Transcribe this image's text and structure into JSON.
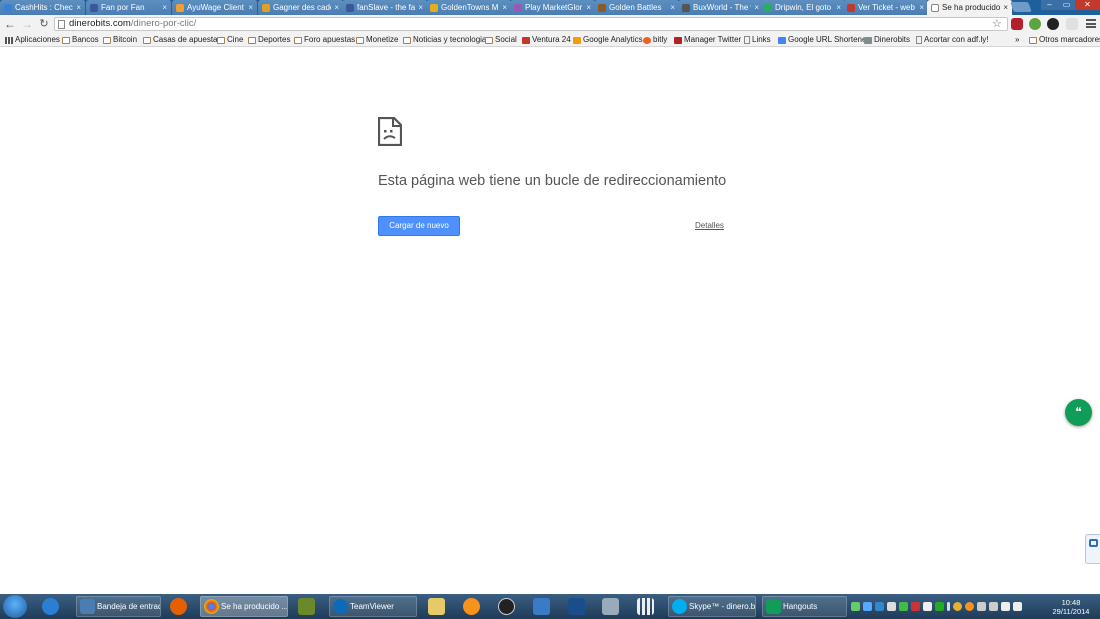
{
  "tabs": [
    {
      "label": "CashHits : Chec",
      "favicon_color": "#3b7dd8"
    },
    {
      "label": "Fan por Fan",
      "favicon_color": "#3b5998"
    },
    {
      "label": "AyuWage Client",
      "favicon_color": "#f0a030"
    },
    {
      "label": "Gagner des cade",
      "favicon_color": "#e0a020"
    },
    {
      "label": "fanSlave - the fa",
      "favicon_color": "#3b5998"
    },
    {
      "label": "GoldenTowns M",
      "favicon_color": "#e0b020"
    },
    {
      "label": "Play MarketGlor",
      "favicon_color": "#9b59b6"
    },
    {
      "label": "Golden Battles",
      "favicon_color": "#8b5a2b"
    },
    {
      "label": "BuxWorld - The w",
      "favicon_color": "#555555"
    },
    {
      "label": "Dripwin, El goto a",
      "favicon_color": "#27ae60"
    },
    {
      "label": "Ver Ticket - web",
      "favicon_color": "#c0392b"
    },
    {
      "label": "Se ha producido",
      "favicon_color": "#ffffff",
      "active": true
    }
  ],
  "tab_close_glyph": "×",
  "window": {
    "min": "–",
    "max": "▭",
    "close": "✕"
  },
  "toolbar": {
    "back_glyph": "←",
    "forward_glyph": "→",
    "reload_glyph": "↻",
    "star_glyph": "☆",
    "url_host": "dinerobits.com",
    "url_path": "/dinero-por-clic/"
  },
  "bookmarks": [
    {
      "label": "Aplicaciones",
      "icon": "apps-icon"
    },
    {
      "label": "Bancos",
      "icon": "folder-icon"
    },
    {
      "label": "Bitcoin",
      "icon": "folder-icon"
    },
    {
      "label": "Casas de apuestas",
      "icon": "folder-icon"
    },
    {
      "label": "Cine",
      "icon": "folder-icon"
    },
    {
      "label": "Deportes",
      "icon": "folder-icon"
    },
    {
      "label": "Foro apuestas",
      "icon": "folder-icon"
    },
    {
      "label": "Monetize",
      "icon": "folder-icon"
    },
    {
      "label": "Noticias y tecnologia",
      "icon": "folder-icon"
    },
    {
      "label": "Social",
      "icon": "folder-icon"
    },
    {
      "label": "Ventura 24",
      "icon": "ventura-icon"
    },
    {
      "label": "Google Analytics",
      "icon": "analytics-icon"
    },
    {
      "label": "bitly",
      "icon": "bitly-icon"
    },
    {
      "label": "Manager Twitter",
      "icon": "twitter-manager-icon"
    },
    {
      "label": "Links",
      "icon": "page-icon"
    },
    {
      "label": "Google URL Shortener",
      "icon": "google-icon"
    },
    {
      "label": "Dinerobits",
      "icon": "dinerobits-icon"
    },
    {
      "label": "Acortar con adf.ly!",
      "icon": "page-icon"
    }
  ],
  "bookmarks_overflow": "»",
  "other_bookmarks": "Otros marcadores",
  "error": {
    "title": "Esta página web tiene un bucle de redireccionamiento",
    "reload_label": "Cargar de nuevo",
    "details_label": "Detalles"
  },
  "hangouts_glyph": "❝",
  "taskbar": {
    "buttons": [
      {
        "label": "Bandeja de entrad..."
      },
      {
        "label": "Se ha producido ..."
      },
      {
        "label": "TeamViewer"
      },
      {
        "label": "Skype™ - dinero.bit"
      },
      {
        "label": "Hangouts"
      }
    ],
    "time": "10:48",
    "date": "29/11/2014"
  },
  "colors": {
    "tabstrip": "#1f5f9c",
    "primary_button": "#4d90fe",
    "hangouts_green": "#0f9d58"
  }
}
